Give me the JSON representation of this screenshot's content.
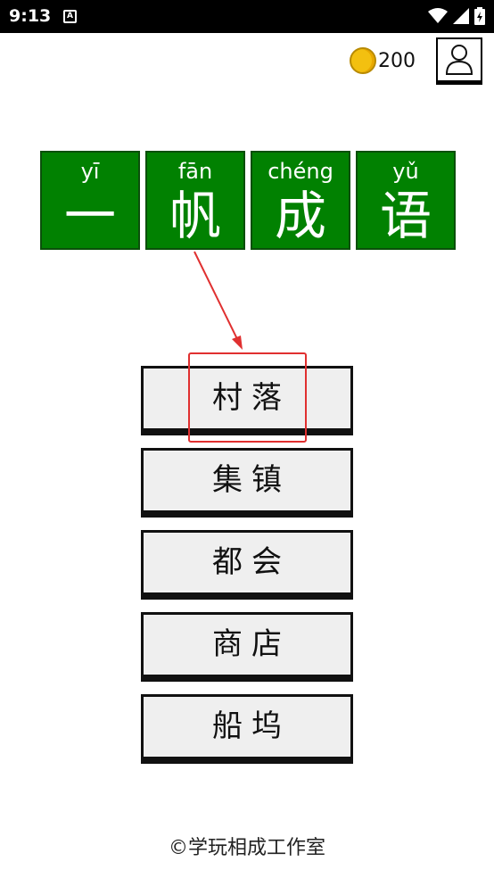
{
  "status_bar": {
    "time": "9:13",
    "app_icon_letter": "A",
    "icons": [
      "wifi-icon",
      "signal-icon",
      "battery-icon"
    ]
  },
  "header": {
    "coin_count": "200",
    "coin_color": "#f3c010"
  },
  "title": {
    "tile_color": "#018101",
    "tiles": [
      {
        "pinyin": "yī",
        "hanzi": "一"
      },
      {
        "pinyin": "fān",
        "hanzi": "帆"
      },
      {
        "pinyin": "chéng",
        "hanzi": "成"
      },
      {
        "pinyin": "yǔ",
        "hanzi": "语"
      }
    ]
  },
  "menu": {
    "items": [
      {
        "label": "村落"
      },
      {
        "label": "集镇"
      },
      {
        "label": "都会"
      },
      {
        "label": "商店"
      },
      {
        "label": "船坞"
      }
    ]
  },
  "annotation": {
    "color": "#e03030",
    "target": "menu.items.0"
  },
  "footer": {
    "copyright": "©学玩相成工作室"
  }
}
